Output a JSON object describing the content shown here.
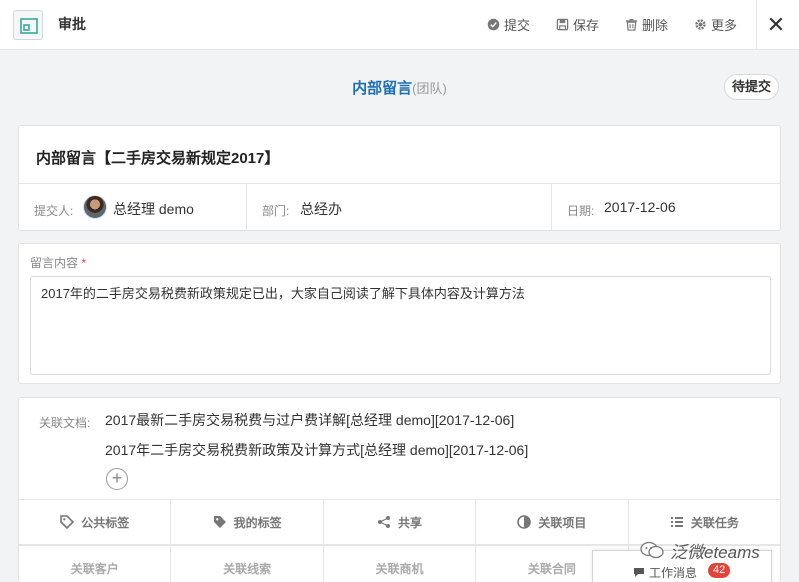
{
  "topbar": {
    "title": "审批",
    "actions": [
      {
        "label": "提交",
        "icon": "check-circle-icon"
      },
      {
        "label": "保存",
        "icon": "save-icon"
      },
      {
        "label": "删除",
        "icon": "trash-icon"
      },
      {
        "label": "更多",
        "icon": "gear-icon"
      }
    ],
    "close_symbol": "✕"
  },
  "header": {
    "title": "内部留言",
    "subtitle": "(团队)",
    "status": "待提交"
  },
  "record": {
    "title": "内部留言【二手房交易新规定2017】",
    "submitter_label": "提交人:",
    "submitter": "总经理 demo",
    "department_label": "部门:",
    "department": "总经办",
    "date_label": "日期:",
    "date": "2017-12-06"
  },
  "message": {
    "label": "留言内容",
    "required_mark": "*",
    "content": "2017年的二手房交易税费新政策规定已出，大家自己阅读了解下具体内容及计算方法"
  },
  "related": {
    "label": "关联文档:",
    "docs": [
      "2017最新二手房交易税费与过户费详解[总经理 demo][2017-12-06]",
      "2017年二手房交易税费新政策及计算方式[总经理 demo][2017-12-06]"
    ],
    "add_symbol": "+"
  },
  "tabs": [
    {
      "label": "公共标签",
      "icon": "tag-icon"
    },
    {
      "label": "我的标签",
      "icon": "tag-filled-icon"
    },
    {
      "label": "共享",
      "icon": "share-icon"
    },
    {
      "label": "关联项目",
      "icon": "pie-icon"
    },
    {
      "label": "关联任务",
      "icon": "list-icon"
    }
  ],
  "tabs_row2": [
    {
      "label": "关联客户"
    },
    {
      "label": "关联线索"
    },
    {
      "label": "关联商机"
    },
    {
      "label": "关联合同"
    }
  ],
  "chat": {
    "label": "工作消息",
    "count": "42"
  },
  "watermark": "泛微eteams",
  "colors": {
    "accent": "#1f6fb2",
    "badge": "#e0443a",
    "background": "#f2f3f5"
  }
}
